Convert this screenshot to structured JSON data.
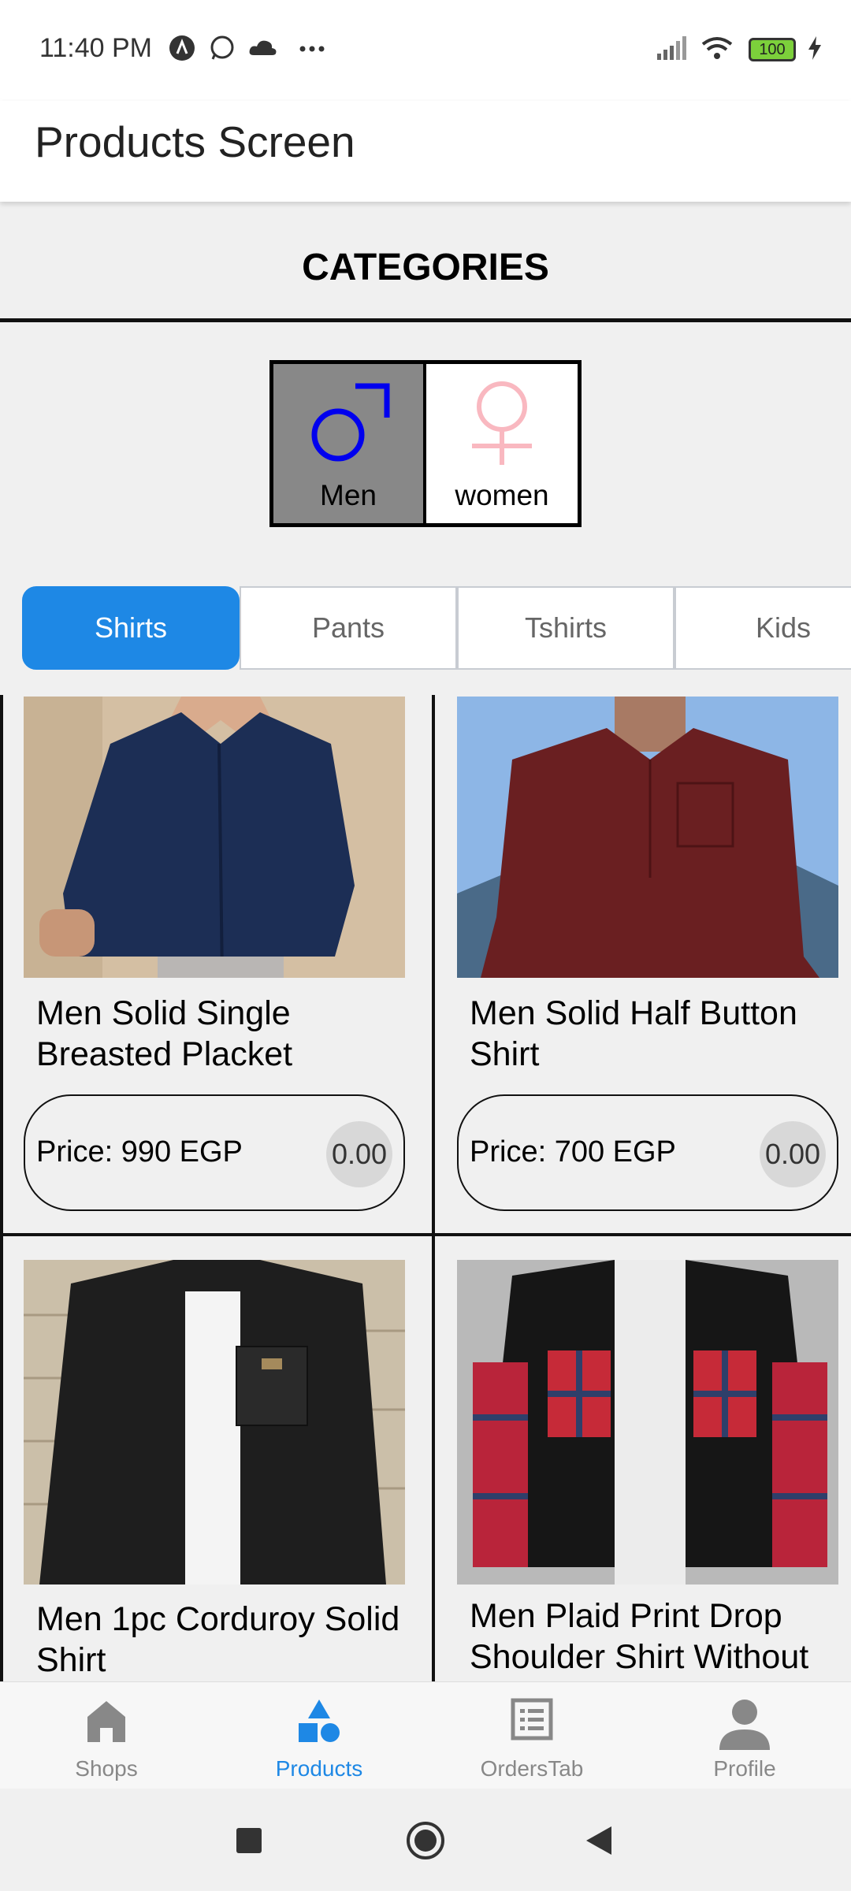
{
  "status_bar": {
    "time": "11:40 PM",
    "battery": "100",
    "icons": [
      "app-a-icon",
      "whatsapp-icon",
      "cloud-icon",
      "more-dots-icon",
      "signal-icon",
      "wifi-icon",
      "battery-icon",
      "charging-icon"
    ]
  },
  "app_bar": {
    "title": "Products Screen"
  },
  "categories": {
    "title": "CATEGORIES",
    "genders": [
      {
        "label": "Men",
        "icon": "male-symbol-icon",
        "selected": true,
        "color": "#0000ee"
      },
      {
        "label": "women",
        "icon": "female-symbol-icon",
        "selected": false,
        "color": "#f9b8c0"
      }
    ]
  },
  "tabs": [
    {
      "label": "Shirts",
      "active": true
    },
    {
      "label": "Pants",
      "active": false
    },
    {
      "label": "Tshirts",
      "active": false
    },
    {
      "label": "Kids",
      "active": false
    }
  ],
  "products": [
    {
      "name": "Men Solid Single Breasted Placket Curved Hem Shirt",
      "price": "Price: 990 EGP",
      "badge": "0.00",
      "image": "navy-shirt-photo"
    },
    {
      "name": "Men Solid Half Button Shirt",
      "price": "Price: 700 EGP",
      "badge": "0.00",
      "image": "maroon-shirt-photo"
    },
    {
      "name": "Men 1pc Corduroy Solid Shirt",
      "image": "black-corduroy-shirt-photo"
    },
    {
      "name": "Men Plaid Print Drop Shoulder Shirt Without",
      "image": "plaid-shirt-photo"
    }
  ],
  "bottom_nav": [
    {
      "label": "Shops",
      "icon": "home-icon",
      "active": false
    },
    {
      "label": "Products",
      "icon": "shapes-icon",
      "active": true
    },
    {
      "label": "OrdersTab",
      "icon": "list-icon",
      "active": false
    },
    {
      "label": "Profile",
      "icon": "person-icon",
      "active": false
    }
  ],
  "colors": {
    "accent": "#1e88e5",
    "background": "#f0f0f0",
    "men": "#0000ee",
    "women": "#f9b8c0"
  }
}
